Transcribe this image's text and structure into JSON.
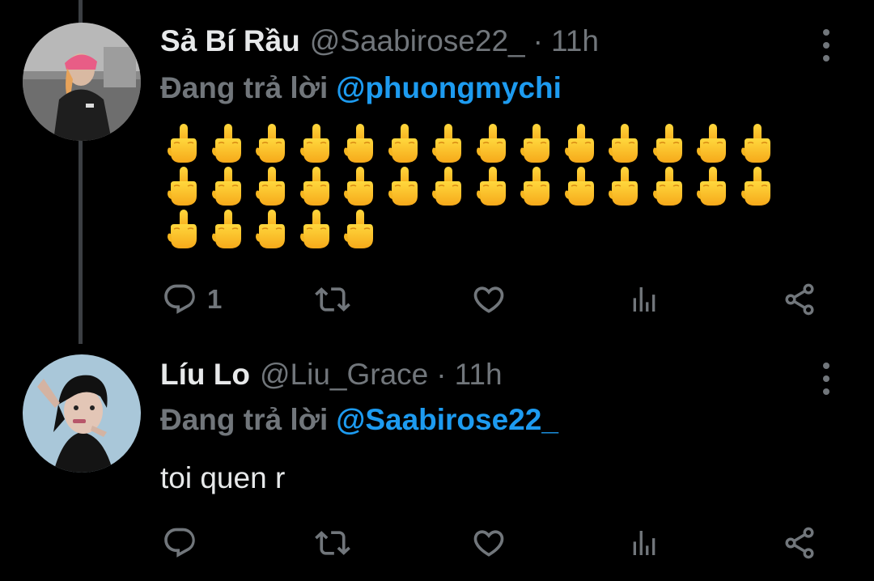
{
  "tweets": [
    {
      "display_name": "Sả Bí Rầu",
      "handle": "@Saabirose22_",
      "separator": "·",
      "time": "11h",
      "replying_prefix": "Đang trả lời",
      "replying_to": "@phuongmychi",
      "emoji_count": 33,
      "emoji_name": "middle-finger-emoji",
      "actions": {
        "reply_count": "1",
        "retweet_count": "",
        "like_count": ""
      }
    },
    {
      "display_name": "Líu Lo",
      "handle": "@Liu_Grace",
      "separator": "·",
      "time": "11h",
      "replying_prefix": "Đang trả lời",
      "replying_to": "@Saabirose22_",
      "text": "toi quen r",
      "actions": {
        "reply_count": "",
        "retweet_count": "",
        "like_count": ""
      }
    }
  ],
  "colors": {
    "background": "#000000",
    "text_primary": "#e7e9ea",
    "text_secondary": "#71767b",
    "accent": "#1d9bf0",
    "thread_line": "#3c3f43"
  },
  "icons": [
    "more-icon",
    "reply-icon",
    "retweet-icon",
    "like-icon",
    "views-icon",
    "share-icon"
  ]
}
